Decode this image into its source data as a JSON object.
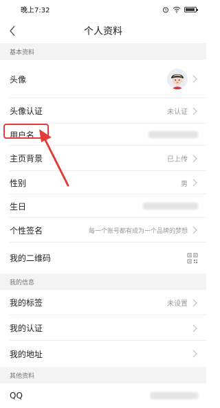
{
  "status_bar": {
    "time": "晚上7:32",
    "icons": [
      "alarm-icon",
      "wifi-icon",
      "battery-icon"
    ],
    "battery_level": 0.8
  },
  "nav": {
    "title": "个人资料",
    "back_icon": "chevron-left-icon"
  },
  "sections": {
    "basic": "基本资料",
    "mine": "我的信息",
    "other": "其他资料"
  },
  "rows": {
    "avatar": {
      "label": "头像"
    },
    "avatar_verify": {
      "label": "头像认证",
      "value": "未认证"
    },
    "username": {
      "label": "用户名"
    },
    "cover": {
      "label": "主页背景",
      "value": "已上传"
    },
    "gender": {
      "label": "性别",
      "value": "男"
    },
    "birthday": {
      "label": "生日"
    },
    "signature": {
      "label": "个性签名",
      "value": "每一个账号都有成为一个品牌的梦想"
    },
    "qrcode": {
      "label": "我的二维码"
    },
    "tags": {
      "label": "我的标签",
      "value": "未设置"
    },
    "certification": {
      "label": "我的认证"
    },
    "address": {
      "label": "我的地址"
    },
    "qq": {
      "label": "QQ"
    }
  },
  "colors": {
    "highlight": "#e53b3b",
    "section_bg": "#f3f3f3",
    "muted_text": "#999999"
  }
}
